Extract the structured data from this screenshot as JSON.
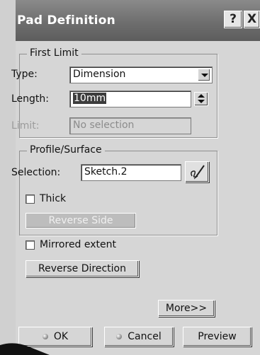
{
  "window": {
    "title": "Pad Definition",
    "help_glyph": "?",
    "close_glyph": "X"
  },
  "first_limit": {
    "legend": "First Limit",
    "type_label": "Type:",
    "type_value": "Dimension",
    "length_label": "Length:",
    "length_value": "10mm",
    "limit_label": "Limit:",
    "limit_value": "No selection"
  },
  "profile": {
    "legend": "Profile/Surface",
    "selection_label": "Selection:",
    "selection_value": "Sketch.2",
    "thick_label": "Thick",
    "reverse_side_label": "Reverse Side"
  },
  "mirrored_label": "Mirrored extent",
  "reverse_direction_label": "Reverse Direction",
  "more_label": "More>>",
  "footer": {
    "ok_label": "OK",
    "cancel_label": "Cancel",
    "preview_label": "Preview"
  }
}
